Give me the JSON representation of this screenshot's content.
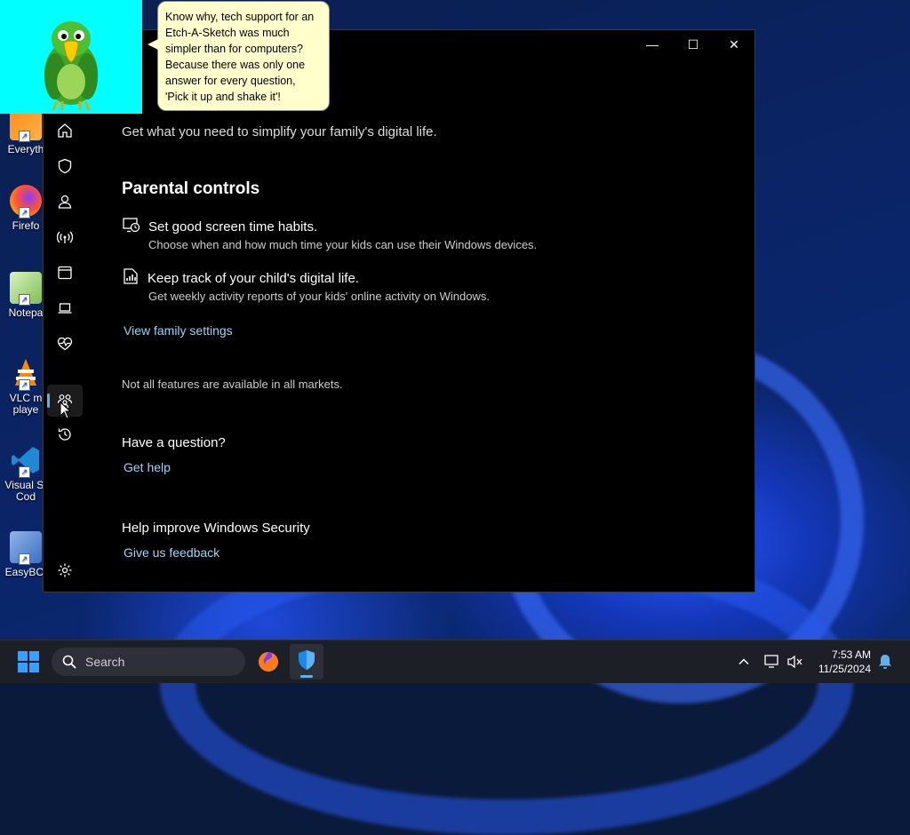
{
  "desktop": {
    "icons": [
      {
        "label": "Everyth",
        "icon": "everything-icon"
      },
      {
        "label": "Firefo",
        "icon": "firefox-icon"
      },
      {
        "label": "Notepa",
        "icon": "notepad-icon"
      },
      {
        "label": "VLC m\nplaye",
        "icon": "vlc-icon"
      },
      {
        "label": "Visual St\nCod",
        "icon": "vscode-icon"
      },
      {
        "label": "EasyBCI",
        "icon": "easybcd-icon"
      }
    ]
  },
  "overlay": {
    "bubble_text": "Know why, tech support for an Etch-A-Sketch was much simpler than for computers? Because there was only one answer for every question, 'Pick it up and shake it'!"
  },
  "window": {
    "title_buttons": {
      "minimize": "—",
      "maximize": "☐",
      "close": "✕"
    },
    "intro": "Get what you need to simplify your family's digital life.",
    "section_title": "Parental controls",
    "features": [
      {
        "title": "Set good screen time habits.",
        "desc": "Choose when and how much time your kids can use their Windows devices.",
        "icon": "screen-time-icon"
      },
      {
        "title": "Keep track of your child's digital life.",
        "desc": "Get weekly activity reports of your kids' online activity on Windows.",
        "icon": "activity-report-icon"
      }
    ],
    "view_family_link": "View family settings",
    "markets_note": "Not all features are available in all markets.",
    "question_heading": "Have a question?",
    "get_help_link": "Get help",
    "improve_heading": "Help improve Windows Security",
    "feedback_link": "Give us feedback"
  },
  "taskbar": {
    "search_placeholder": "Search",
    "time": "7:53 AM",
    "date": "11/25/2024"
  },
  "colors": {
    "link": "#9fd3f7",
    "accent": "#5fb2f2",
    "window_bg": "#000000",
    "taskbar_bg": "#1c1f26"
  }
}
